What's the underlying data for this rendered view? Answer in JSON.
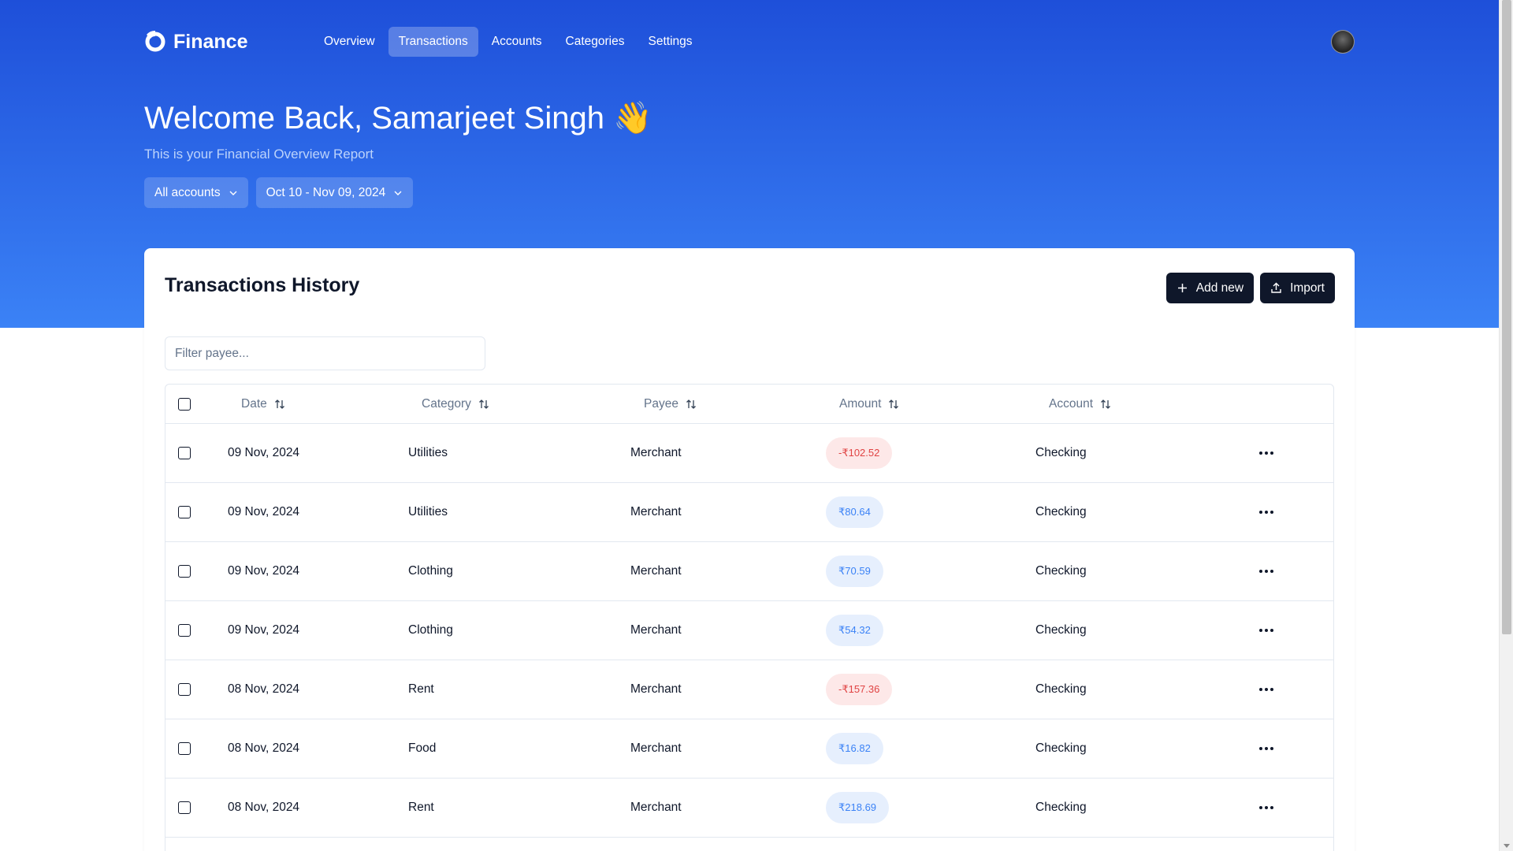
{
  "app": {
    "name": "Finance"
  },
  "nav": {
    "items": [
      {
        "label": "Overview",
        "active": false
      },
      {
        "label": "Transactions",
        "active": true
      },
      {
        "label": "Accounts",
        "active": false
      },
      {
        "label": "Categories",
        "active": false
      },
      {
        "label": "Settings",
        "active": false
      }
    ]
  },
  "hero": {
    "welcome": "Welcome Back, Samarjeet Singh 👋",
    "subtitle": "This is your Financial Overview Report",
    "account_filter": "All accounts",
    "date_filter": "Oct 10 - Nov 09, 2024"
  },
  "card": {
    "title": "Transactions History",
    "add_label": "Add new",
    "import_label": "Import",
    "search_placeholder": "Filter payee..."
  },
  "table": {
    "columns": [
      "Date",
      "Category",
      "Payee",
      "Amount",
      "Account"
    ],
    "rows": [
      {
        "date": "09 Nov, 2024",
        "category": "Utilities",
        "payee": "Merchant",
        "amount": "-₹102.52",
        "type": "neg",
        "account": "Checking"
      },
      {
        "date": "09 Nov, 2024",
        "category": "Utilities",
        "payee": "Merchant",
        "amount": "₹80.64",
        "type": "pos",
        "account": "Checking"
      },
      {
        "date": "09 Nov, 2024",
        "category": "Clothing",
        "payee": "Merchant",
        "amount": "₹70.59",
        "type": "pos",
        "account": "Checking"
      },
      {
        "date": "09 Nov, 2024",
        "category": "Clothing",
        "payee": "Merchant",
        "amount": "₹54.32",
        "type": "pos",
        "account": "Checking"
      },
      {
        "date": "08 Nov, 2024",
        "category": "Rent",
        "payee": "Merchant",
        "amount": "-₹157.36",
        "type": "neg",
        "account": "Checking"
      },
      {
        "date": "08 Nov, 2024",
        "category": "Food",
        "payee": "Merchant",
        "amount": "₹16.82",
        "type": "pos",
        "account": "Checking"
      },
      {
        "date": "08 Nov, 2024",
        "category": "Rent",
        "payee": "Merchant",
        "amount": "₹218.69",
        "type": "pos",
        "account": "Checking"
      }
    ]
  },
  "colors": {
    "hero_top": "#1e4fd9",
    "hero_bottom": "#3b82f6",
    "negative_bg": "#fde8e8",
    "negative_text": "#e04343",
    "positive_bg": "#e6effd",
    "positive_text": "#3b82f6",
    "dark_button": "#0f172a"
  },
  "icons": {
    "logo": "finance-logo-icon",
    "chevron": "chevron-down-icon",
    "sort": "sort-arrows-icon",
    "add": "plus-icon",
    "import": "upload-icon",
    "row_menu": "more-horizontal-icon"
  }
}
